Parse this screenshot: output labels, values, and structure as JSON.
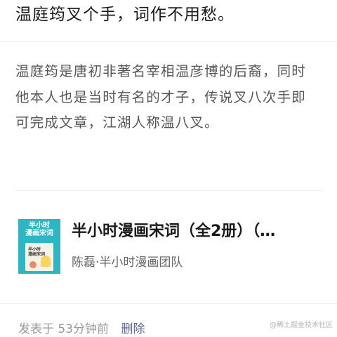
{
  "post": {
    "title": "温庭筠叉个手，词作不用愁。",
    "body": "温庭筠是唐初非著名宰相温彦博的后裔，同时他本人也是当时有名的才子，传说叉八次手即可完成文章，江湖人称温八叉。"
  },
  "book": {
    "title": "半小时漫画宋词（全2册）（…",
    "author": "陈磊·半小时漫画团队",
    "cover": {
      "title_line1": "半小时",
      "title_line2": "漫画宋词",
      "box_line1": "半小时",
      "box_line2": "漫画宋词",
      "bg_color": "#2fb6c4"
    }
  },
  "footer": {
    "publish_time": "发表于 53分钟前",
    "delete_label": "删除"
  },
  "watermark": "@稀土掘金技术社区"
}
